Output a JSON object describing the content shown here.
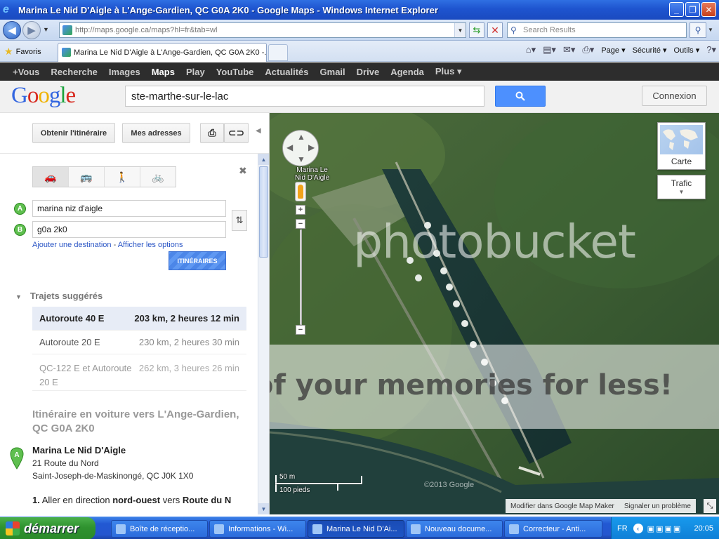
{
  "window": {
    "title": "Marina Le Nid D'Aigle à L'Ange-Gardien, QC G0A 2K0 - Google Maps - Windows Internet Explorer"
  },
  "browser": {
    "url": "http://maps.google.ca/maps?hl=fr&tab=wl",
    "search_placeholder": "Search Results",
    "favorites_label": "Favoris",
    "tab_title": "Marina Le Nid D'Aigle à L'Ange-Gardien, QC G0A 2K0 -...",
    "menu": {
      "page": "Page",
      "security": "Sécurité",
      "tools": "Outils"
    }
  },
  "gbar": {
    "items": [
      "+Vous",
      "Recherche",
      "Images",
      "Maps",
      "Play",
      "YouTube",
      "Actualités",
      "Gmail",
      "Drive",
      "Agenda",
      "Plus"
    ],
    "active": "Maps"
  },
  "header": {
    "search_value": "ste-marthe-sur-le-lac",
    "connexion_label": "Connexion"
  },
  "toolbar": {
    "itinerary_label": "Obtenir l'itinéraire",
    "my_places_label": "Mes adresses"
  },
  "directions": {
    "origin": "marina niz d'aigle",
    "destination": "g0a 2k0",
    "marker_a": "A",
    "marker_b": "B",
    "add_destination": "Ajouter une destination",
    "show_options": "Afficher les options",
    "submit_label": "ITINÉRAIRES"
  },
  "suggested": {
    "heading": "Trajets suggérés",
    "routes": [
      {
        "name": "Autoroute 40 E",
        "detail": "203 km, 2 heures 12 min"
      },
      {
        "name": "Autoroute 20 E",
        "detail": "230 km, 2 heures 30 min"
      },
      {
        "name": "QC-122 E et Autoroute 20 E",
        "detail": "262 km, 3 heures 26 min"
      }
    ]
  },
  "itinerary": {
    "title": "Itinéraire en voiture vers L'Ange-Gardien, QC G0A 2K0",
    "start_marker": "A",
    "place_name": "Marina Le Nid D'Aigle",
    "address_line1": "21 Route du Nord",
    "address_line2": "Saint-Joseph-de-Maskinongé, QC J0K 1X0",
    "step1_num": "1.",
    "step1_text": "Aller en direction",
    "step1_dir": "nord-ouest",
    "step1_to": "vers",
    "step1_road": "Route du N"
  },
  "map": {
    "place_label_1": "Marina Le",
    "place_label_2": "Nid D'Aigle",
    "carte_label": "Carte",
    "traffic_label": "Trafic",
    "scale_metric": "50 m",
    "scale_imperial": "100 pieds",
    "copyright": "©2013 Google",
    "footer_edit": "Modifier dans Google Map Maker",
    "footer_report": "Signaler un problème",
    "watermark_1": "photobucket",
    "watermark_2": "of your memories for less!"
  },
  "taskbar": {
    "start_label": "démarrer",
    "tasks": [
      {
        "label": "Boîte de réceptio..."
      },
      {
        "label": "Informations - Wi..."
      },
      {
        "label": "Marina Le Nid D'Ai..."
      },
      {
        "label": "Nouveau docume..."
      },
      {
        "label": "Correcteur - Anti..."
      }
    ],
    "lang": "FR",
    "clock": "20:05"
  },
  "colors": {
    "google_blue_button": "#4d90fe",
    "marker_green": "#5fbf4f",
    "link_blue": "#2a55c5",
    "gbar_bg": "#2d2d2d"
  }
}
